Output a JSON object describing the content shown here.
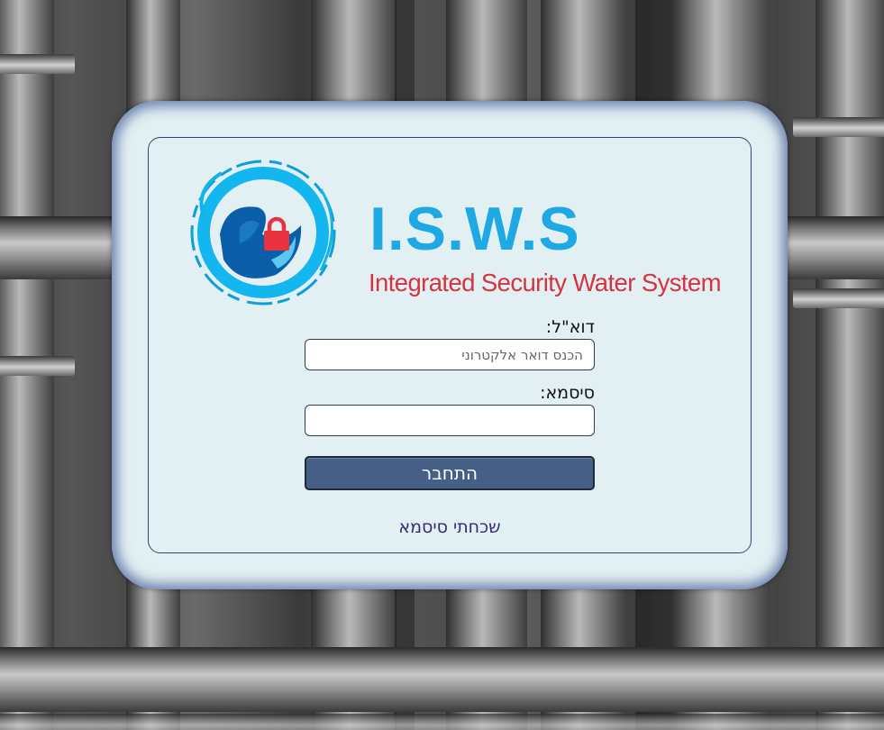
{
  "brand": {
    "title": "I.S.W.S",
    "subtitle": "Integrated Security Water System",
    "colors": {
      "title": "#1ea8e4",
      "subtitle": "#d5333f",
      "lock": "#e8323f"
    }
  },
  "form": {
    "email_label": "דוא\"ל:",
    "email_placeholder": "הכנס דואר אלקטרוני",
    "email_value": "",
    "password_label": "סיסמא:",
    "password_value": "",
    "submit_label": "התחבר",
    "forgot_label": "שכחתי סיסמא"
  },
  "theme": {
    "card_bg": "#e2f0f3",
    "button_bg": "#465f86",
    "link_color": "#3a2a74"
  },
  "icons": [
    "lock-icon",
    "water-swirl-icon"
  ]
}
